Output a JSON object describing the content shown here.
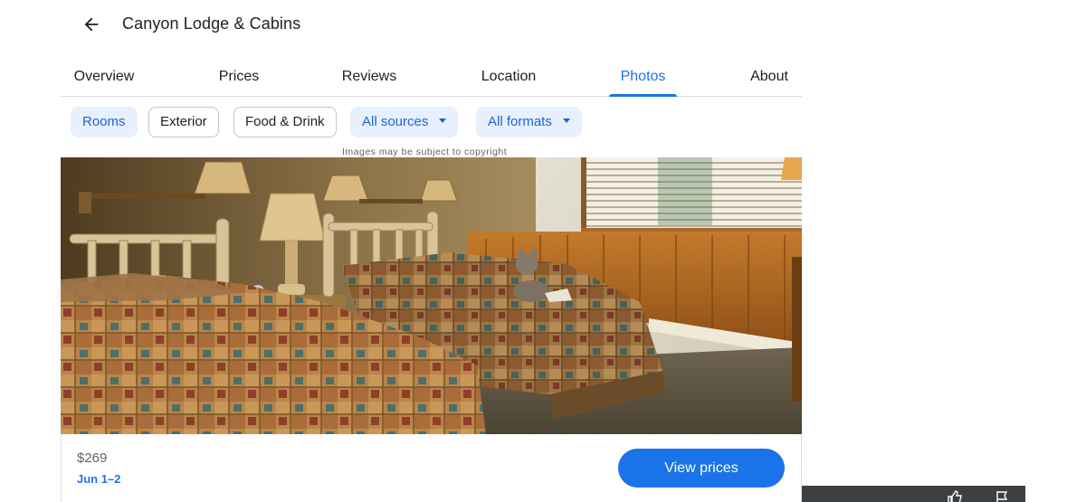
{
  "header": {
    "title": "Canyon Lodge & Cabins",
    "back_icon": "arrow-back-icon"
  },
  "tabs": [
    {
      "label": "Overview",
      "active": false
    },
    {
      "label": "Prices",
      "active": false
    },
    {
      "label": "Reviews",
      "active": false
    },
    {
      "label": "Location",
      "active": false
    },
    {
      "label": "Photos",
      "active": true
    },
    {
      "label": "About",
      "active": false
    }
  ],
  "filters": {
    "chips": [
      {
        "label": "Rooms",
        "selected": true
      },
      {
        "label": "Exterior",
        "selected": false
      },
      {
        "label": "Food & Drink",
        "selected": false
      }
    ],
    "dropdowns": [
      {
        "label": "All sources"
      },
      {
        "label": "All formats"
      }
    ]
  },
  "photo": {
    "copyright_note": "Images may be subject to copyright"
  },
  "price_card": {
    "price": "$269",
    "dates": "Jun 1–2",
    "button_label": "View prices"
  },
  "colors": {
    "accent": "#1a73e8",
    "chip_selected_bg": "#e8f0fe",
    "dark_strip": "#3c4043"
  },
  "strip_icons": [
    "thumb-up-icon",
    "flag-icon"
  ]
}
